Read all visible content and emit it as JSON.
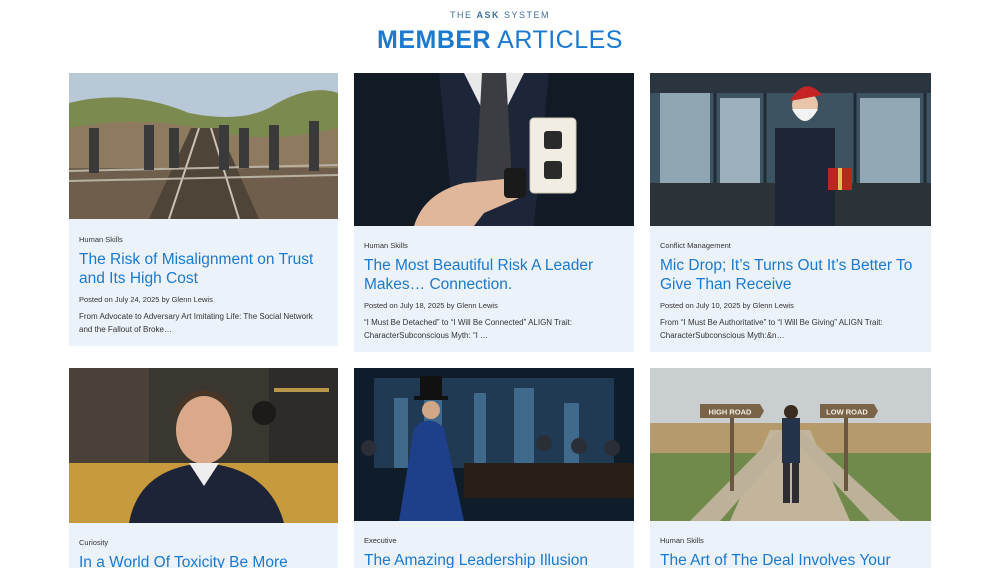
{
  "header": {
    "eyebrow_pre": "THE ",
    "eyebrow_bold": "ASK",
    "eyebrow_post": " SYSTEM",
    "title_bold": "MEMBER",
    "title_light": " ARTICLES"
  },
  "articles": [
    {
      "category": "Human Skills",
      "title": "The Risk of Misalignment on Trust and Its High Cost",
      "meta": "Posted on July 24, 2025 by Glenn Lewis",
      "excerpt": "From Advocate to Adversary Art Imitating Life: The Social Network and the Fallout of Broke…",
      "image_icon": "railroad-tracks-image"
    },
    {
      "category": "Human Skills",
      "title": "The Most Beautiful Risk A Leader Makes… Connection.",
      "meta": "Posted on July 18, 2025 by Glenn Lewis",
      "excerpt": "“I Must Be Detached” to “I Will Be Connected” ALIGN Trait: CharacterSubconscious Myth: “I …",
      "image_icon": "power-plug-image"
    },
    {
      "category": "Conflict Management",
      "title": "Mic Drop; It’s Turns Out It’s Better To Give Than Receive",
      "meta": "Posted on July 10, 2025 by Glenn Lewis",
      "excerpt": "From “I Must Be Authoritative” to “I Will Be Giving” ALIGN Trait: CharacterSubconscious Myth:&n…",
      "image_icon": "santa-gift-image"
    },
    {
      "category": "Curiosity",
      "title": "In a World Of Toxicity Be More",
      "meta": "",
      "excerpt": "",
      "image_icon": "smiling-man-image"
    },
    {
      "category": "Executive",
      "title": "The Amazing Leadership Illusion",
      "meta": "",
      "excerpt": "",
      "image_icon": "magician-boardroom-image"
    },
    {
      "category": "Human Skills",
      "title": "The Art of The Deal Involves Your",
      "meta": "",
      "excerpt": "",
      "image_icon": "crossroads-image"
    }
  ],
  "signs": {
    "left": "HIGH ROAD",
    "right": "LOW ROAD"
  },
  "colors": {
    "accent": "#1b79d0",
    "card_bg": "#ecf2f9"
  }
}
